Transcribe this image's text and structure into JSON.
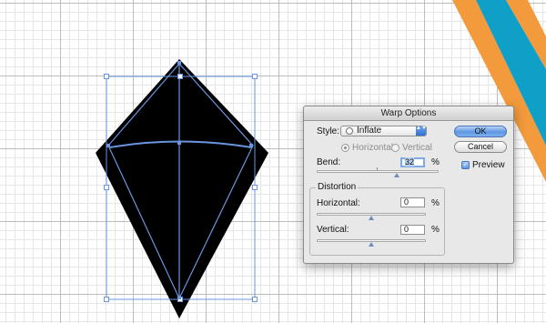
{
  "dialog": {
    "title": "Warp Options",
    "style_label": "Style:",
    "style_value": "Inflate",
    "orientation": {
      "horizontal_label": "Horizontal",
      "vertical_label": "Vertical",
      "selected": "Horizontal"
    },
    "bend": {
      "label": "Bend:",
      "value": "32",
      "unit": "%",
      "level_percent": 32
    },
    "distortion": {
      "group_label": "Distortion",
      "horizontal": {
        "label": "Horizontal:",
        "value": "0",
        "unit": "%",
        "level_percent": 0
      },
      "vertical": {
        "label": "Vertical:",
        "value": "0",
        "unit": "%",
        "level_percent": 0
      }
    },
    "buttons": {
      "ok": "OK",
      "cancel": "Cancel"
    },
    "preview": {
      "label": "Preview",
      "checked": true,
      "check_mark": "✓"
    },
    "select_arrows": "▲▼"
  },
  "artwork": {
    "shape_fill": "#000000",
    "guide_color": "#6a95e0",
    "banner_colors": [
      "#f39a3c",
      "#0f9fc7"
    ]
  }
}
